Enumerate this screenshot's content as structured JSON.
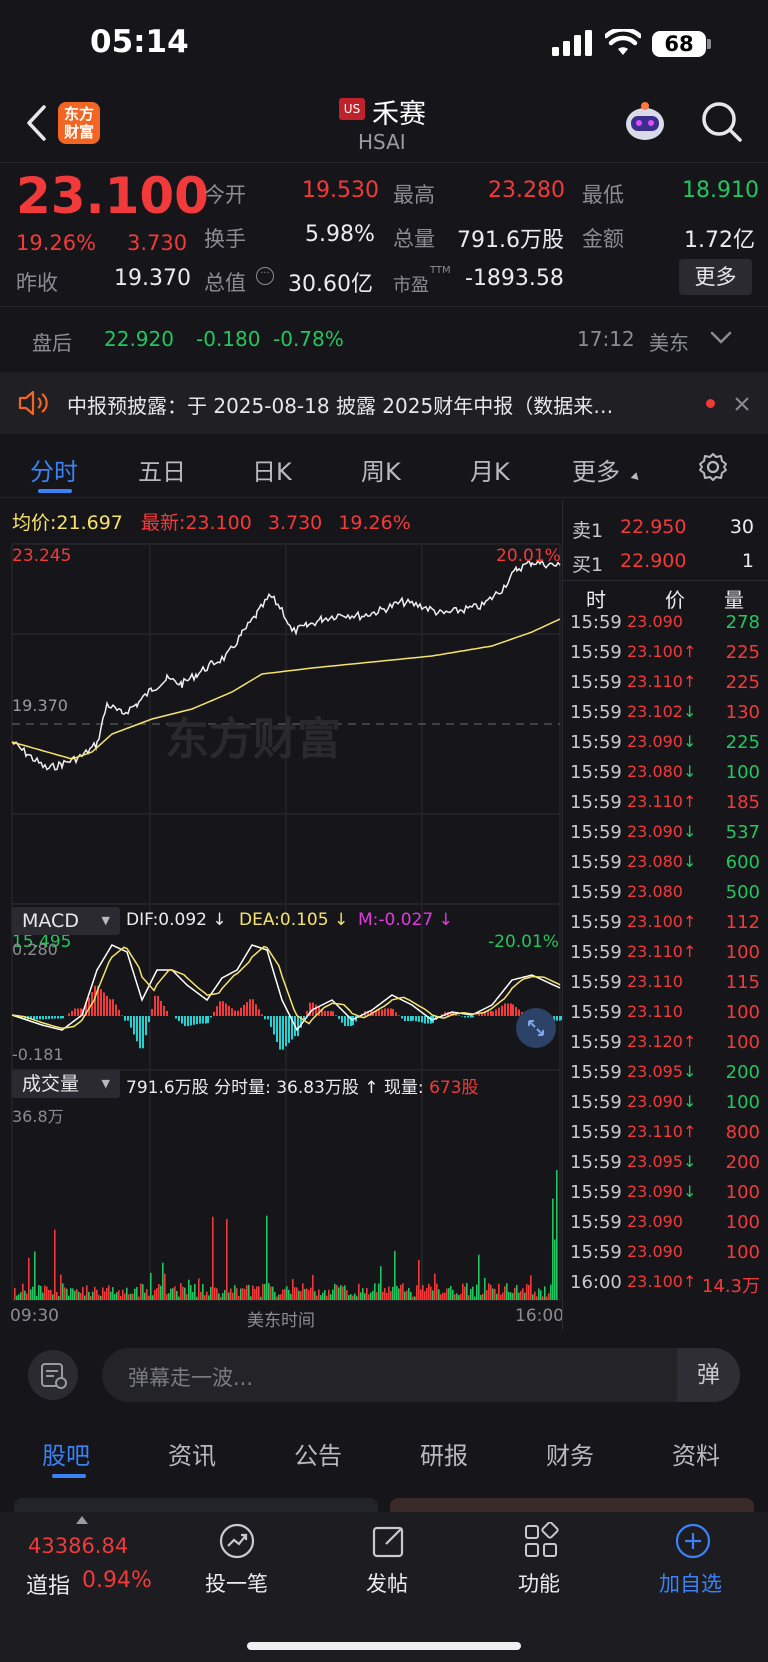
{
  "status": {
    "time": "05:14",
    "battery": "68"
  },
  "nav": {
    "logo_text": "东方财富",
    "market_badge": "US",
    "stock_name": "禾赛",
    "ticker": "HSAI"
  },
  "quote": {
    "price": "23.100",
    "change_pct": "19.26%",
    "change": "3.730",
    "prev_close_label": "昨收",
    "prev_close": "19.370",
    "open_label": "今开",
    "open": "19.530",
    "high_label": "最高",
    "high": "23.280",
    "low_label": "最低",
    "low": "18.910",
    "turnover_label": "换手",
    "turnover": "5.98%",
    "volume_label": "总量",
    "volume": "791.6万股",
    "amount_label": "金额",
    "amount": "1.72亿",
    "mcap_label": "总值",
    "mcap": "30.60亿",
    "pe_label": "市盈",
    "pe_sup": "TTM",
    "pe": "-1893.58",
    "more_label": "更多"
  },
  "afterhours": {
    "label": "盘后",
    "price": "22.920",
    "change": "-0.180",
    "pct": "-0.78%",
    "time": "17:12",
    "zone": "美东"
  },
  "notice": {
    "text": "中报预披露：于 2025-08-18 披露 2025财年中报（数据来…"
  },
  "tabs": [
    "分时",
    "五日",
    "日K",
    "周K",
    "月K",
    "更多"
  ],
  "chart_info": {
    "avg_label": "均价:",
    "avg": "21.697",
    "last_label": "最新:",
    "last": "23.100",
    "chg": "3.730",
    "pct": "19.26%"
  },
  "price_axis": {
    "top": "23.245",
    "ref": "19.370",
    "bottom": "15.495",
    "top_pct": "20.01%",
    "bottom_pct": "-20.01%"
  },
  "watermark": "东方财富",
  "macd": {
    "label": "MACD",
    "dif": "DIF:0.092 ↓",
    "dea": "DEA:0.105 ↓",
    "m": "M:-0.027 ↓",
    "top": "0.280",
    "bottom": "-0.181"
  },
  "volume": {
    "label": "成交量",
    "info": "791.6万股 分时量: 36.83万股 ↑ 现量:",
    "current": "673股",
    "top": "36.8万"
  },
  "time_axis": {
    "start": "09:30",
    "mid": "美东时间",
    "end": "16:00"
  },
  "orderbook": {
    "ask_label": "卖1",
    "ask_price": "22.950",
    "ask_vol": "30",
    "bid_label": "买1",
    "bid_price": "22.900",
    "bid_vol": "1",
    "headers": [
      "时",
      "价",
      "量"
    ]
  },
  "trades": [
    {
      "t": "15:59",
      "p": "23.090",
      "a": "",
      "q": "278",
      "qc": "green"
    },
    {
      "t": "15:59",
      "p": "23.100",
      "a": "↑",
      "q": "225",
      "qc": "red"
    },
    {
      "t": "15:59",
      "p": "23.110",
      "a": "↑",
      "q": "225",
      "qc": "red"
    },
    {
      "t": "15:59",
      "p": "23.102",
      "a": "↓",
      "q": "130",
      "qc": "red"
    },
    {
      "t": "15:59",
      "p": "23.090",
      "a": "↓",
      "q": "225",
      "qc": "green"
    },
    {
      "t": "15:59",
      "p": "23.080",
      "a": "↓",
      "q": "100",
      "qc": "green"
    },
    {
      "t": "15:59",
      "p": "23.110",
      "a": "↑",
      "q": "185",
      "qc": "red"
    },
    {
      "t": "15:59",
      "p": "23.090",
      "a": "↓",
      "q": "537",
      "qc": "green"
    },
    {
      "t": "15:59",
      "p": "23.080",
      "a": "↓",
      "q": "600",
      "qc": "green"
    },
    {
      "t": "15:59",
      "p": "23.080",
      "a": "",
      "q": "500",
      "qc": "green"
    },
    {
      "t": "15:59",
      "p": "23.100",
      "a": "↑",
      "q": "112",
      "qc": "red"
    },
    {
      "t": "15:59",
      "p": "23.110",
      "a": "↑",
      "q": "100",
      "qc": "red"
    },
    {
      "t": "15:59",
      "p": "23.110",
      "a": "",
      "q": "115",
      "qc": "red"
    },
    {
      "t": "15:59",
      "p": "23.110",
      "a": "",
      "q": "100",
      "qc": "red"
    },
    {
      "t": "15:59",
      "p": "23.120",
      "a": "↑",
      "q": "100",
      "qc": "red"
    },
    {
      "t": "15:59",
      "p": "23.095",
      "a": "↓",
      "q": "200",
      "qc": "green"
    },
    {
      "t": "15:59",
      "p": "23.090",
      "a": "↓",
      "q": "100",
      "qc": "green"
    },
    {
      "t": "15:59",
      "p": "23.110",
      "a": "↑",
      "q": "800",
      "qc": "red"
    },
    {
      "t": "15:59",
      "p": "23.095",
      "a": "↓",
      "q": "200",
      "qc": "red"
    },
    {
      "t": "15:59",
      "p": "23.090",
      "a": "↓",
      "q": "100",
      "qc": "red"
    },
    {
      "t": "15:59",
      "p": "23.090",
      "a": "",
      "q": "100",
      "qc": "red"
    },
    {
      "t": "15:59",
      "p": "23.090",
      "a": "",
      "q": "100",
      "qc": "red"
    },
    {
      "t": "16:00",
      "p": "23.100",
      "a": "↑",
      "q": "14.3万",
      "qc": "red"
    }
  ],
  "input": {
    "placeholder": "弹幕走一波...",
    "danmu_btn": "弹"
  },
  "subtabs": [
    "股吧",
    "资讯",
    "公告",
    "研报",
    "财务",
    "资料"
  ],
  "bottom": {
    "index_value": "43386.84",
    "index_name": "道指",
    "index_pct": "0.94%",
    "actions": [
      "投一笔",
      "发帖",
      "功能",
      "加自选"
    ]
  },
  "colors": {
    "up": "#f23a3a",
    "down": "#22c55e",
    "accent": "#3b82f6",
    "avg_line": "#f5e36b"
  }
}
